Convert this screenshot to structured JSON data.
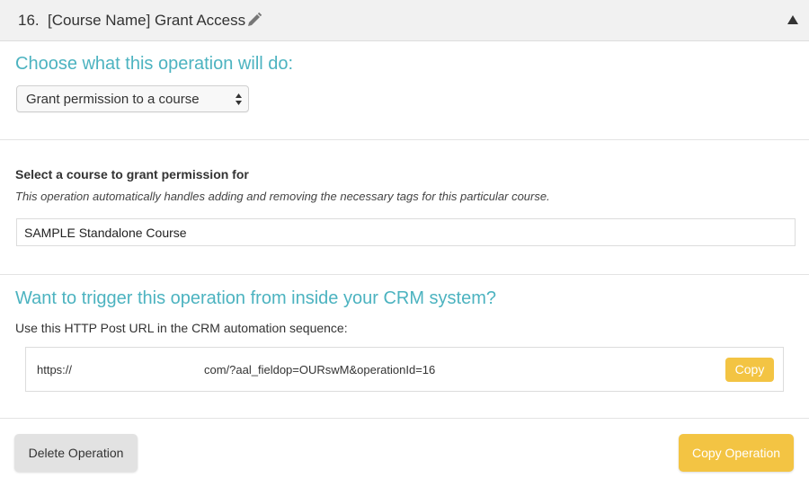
{
  "header": {
    "number": "16.",
    "title": "[Course Name] Grant Access",
    "edit_icon": "pencil-icon",
    "collapse_icon": "caret-up-icon"
  },
  "operation": {
    "heading": "Choose what this operation will do:",
    "selected": "Grant permission to a course"
  },
  "course": {
    "label": "Select a course to grant permission for",
    "help": "This operation automatically handles adding and removing the necessary tags for this particular course.",
    "value": "SAMPLE Standalone Course"
  },
  "crm": {
    "heading": "Want to trigger this operation from inside your CRM system?",
    "label": "Use this HTTP Post URL in the CRM automation sequence:",
    "url_start": "https://",
    "url_end": "com/?aal_fieldop=OURswM&operationId=16",
    "copy_label": "Copy"
  },
  "footer": {
    "delete_label": "Delete Operation",
    "copy_op_label": "Copy Operation"
  },
  "colors": {
    "accent_teal": "#4cb3c0",
    "button_yellow": "#f3c443",
    "header_bg": "#f1f1f1"
  }
}
